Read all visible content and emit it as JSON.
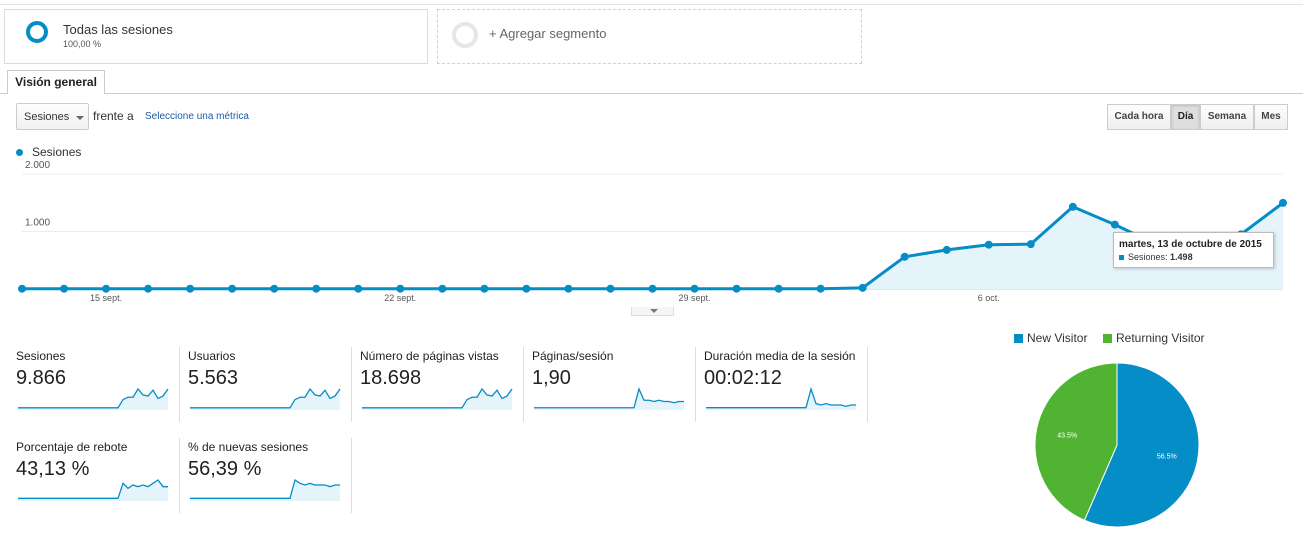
{
  "segments": {
    "primary": {
      "title": "Todas las sesiones",
      "percent": "100,00 %"
    },
    "add_label": "+ Agregar segmento"
  },
  "tab": {
    "label": "Visión general"
  },
  "controls": {
    "metric_select": "Sesiones",
    "vs_label": "frente a",
    "second_metric_link": "Seleccione una métrica",
    "granularity": [
      "Cada hora",
      "Día",
      "Semana",
      "Mes"
    ],
    "granularity_selected": "Día"
  },
  "colors": {
    "series": "#058dc7",
    "new_visitor": "#058dc7",
    "returning_visitor": "#50b432",
    "area": "#e5f3fa"
  },
  "chart_data": {
    "type": "area",
    "series": [
      {
        "name": "Sesiones",
        "values": [
          5,
          5,
          5,
          5,
          5,
          5,
          5,
          5,
          5,
          5,
          5,
          5,
          5,
          5,
          5,
          5,
          5,
          5,
          5,
          5,
          20,
          560,
          680,
          770,
          780,
          1430,
          1120,
          770,
          800,
          950,
          1498
        ]
      }
    ],
    "y_ticks": [
      "2.000",
      "1.000"
    ],
    "ylim": [
      0,
      2000
    ],
    "x_tick_labels": [
      {
        "index": 2,
        "label": "15 sept."
      },
      {
        "index": 9,
        "label": "22 sept."
      },
      {
        "index": 16,
        "label": "29 sept."
      },
      {
        "index": 23,
        "label": "6 oct."
      }
    ],
    "grid": true,
    "legend": "top-left",
    "tooltip": {
      "index": 30,
      "date": "martes, 13 de octubre de 2015",
      "series_label": "Sesiones:",
      "value": "1.498"
    }
  },
  "metrics": [
    {
      "label": "Sesiones",
      "value": "9.866",
      "spark": [
        1,
        1,
        1,
        1,
        1,
        1,
        1,
        1,
        1,
        1,
        1,
        1,
        1,
        1,
        1,
        1,
        1,
        1,
        1,
        1,
        1,
        8,
        10,
        10,
        17,
        12,
        11,
        16,
        9,
        11,
        17
      ]
    },
    {
      "label": "Usuarios",
      "value": "5.563",
      "spark": [
        1,
        1,
        1,
        1,
        1,
        1,
        1,
        1,
        1,
        1,
        1,
        1,
        1,
        1,
        1,
        1,
        1,
        1,
        1,
        1,
        1,
        8,
        10,
        10,
        17,
        12,
        11,
        16,
        9,
        11,
        17
      ]
    },
    {
      "label": "Número de páginas vistas",
      "value": "18.698",
      "spark": [
        1,
        1,
        1,
        1,
        1,
        1,
        1,
        1,
        1,
        1,
        1,
        1,
        1,
        1,
        1,
        1,
        1,
        1,
        1,
        1,
        1,
        8,
        10,
        10,
        17,
        12,
        11,
        16,
        9,
        11,
        17
      ]
    },
    {
      "label": "Páginas/sesión",
      "value": "1,90",
      "spark": [
        1,
        1,
        1,
        1,
        1,
        1,
        1,
        1,
        1,
        1,
        1,
        1,
        1,
        1,
        1,
        1,
        1,
        1,
        1,
        1,
        1,
        16,
        7,
        7,
        6,
        7,
        6,
        6,
        5,
        6,
        6
      ]
    },
    {
      "label": "Duración media de la sesión",
      "value": "00:02:12",
      "spark": [
        1,
        1,
        1,
        1,
        1,
        1,
        1,
        1,
        1,
        1,
        1,
        1,
        1,
        1,
        1,
        1,
        1,
        1,
        1,
        1,
        1,
        15,
        4,
        3,
        4,
        3,
        3,
        3,
        2,
        3,
        3
      ]
    },
    {
      "label": "Porcentaje de rebote",
      "value": "43,13 %",
      "spark": [
        1,
        1,
        1,
        1,
        1,
        1,
        1,
        1,
        1,
        1,
        1,
        1,
        1,
        1,
        1,
        1,
        1,
        1,
        1,
        1,
        1,
        10,
        7,
        9,
        8,
        9,
        8,
        10,
        12,
        8,
        8
      ]
    },
    {
      "label": "% de nuevas sesiones",
      "value": "56,39 %",
      "spark": [
        1,
        1,
        1,
        1,
        1,
        1,
        1,
        1,
        1,
        1,
        1,
        1,
        1,
        1,
        1,
        1,
        1,
        1,
        1,
        1,
        1,
        12,
        10,
        9,
        10,
        9,
        9,
        9,
        8,
        9,
        9
      ]
    }
  ],
  "pie": {
    "legend": [
      "New Visitor",
      "Returning Visitor"
    ],
    "slices": [
      {
        "name": "New Visitor",
        "value": 56.5,
        "label": "56.5%"
      },
      {
        "name": "Returning Visitor",
        "value": 43.5,
        "label": "43.5%"
      }
    ]
  }
}
